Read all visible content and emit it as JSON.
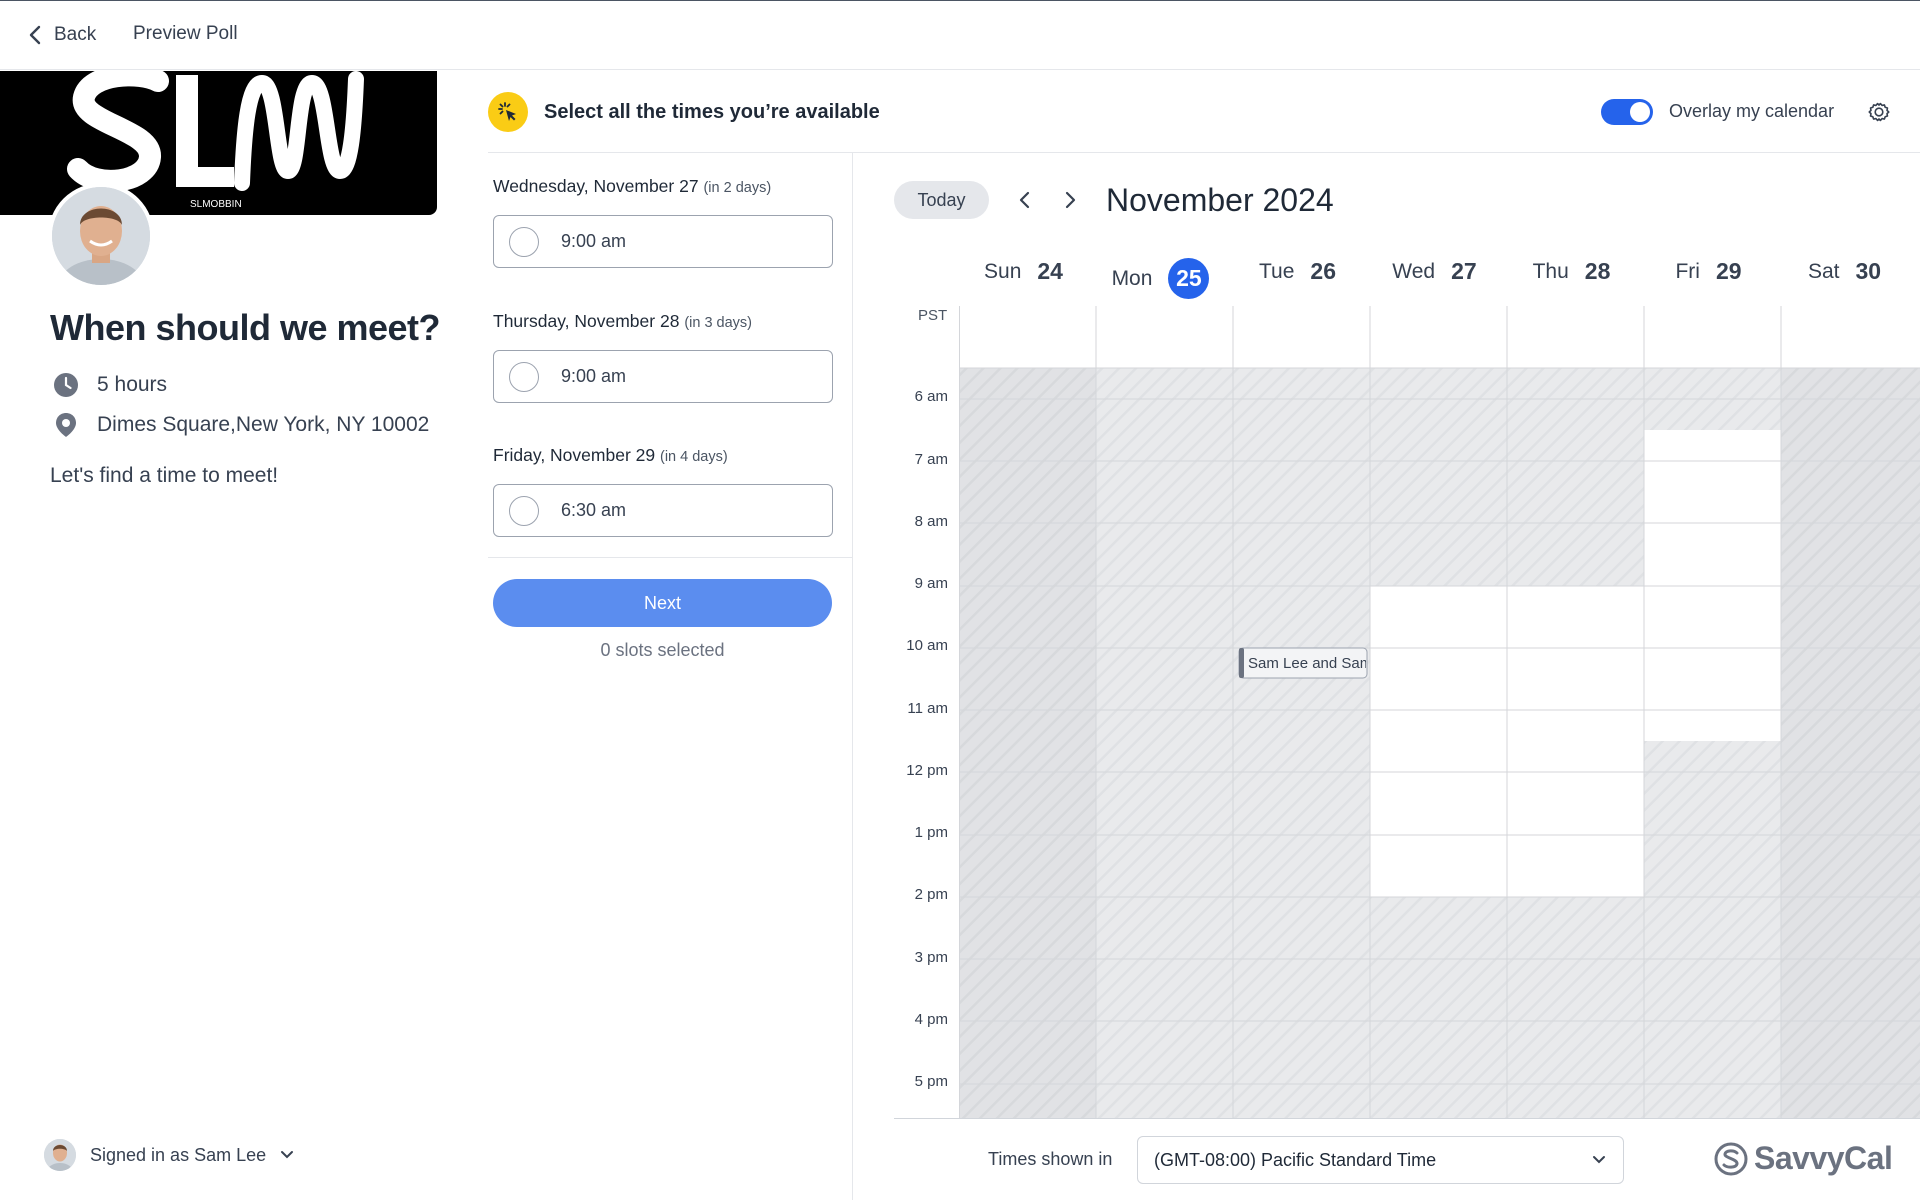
{
  "topbar": {
    "back_label": "Back",
    "title": "Preview Poll"
  },
  "host": {
    "banner_logo": "SLM",
    "banner_sub": "SLMOBBIN"
  },
  "event": {
    "title": "When should we meet?",
    "duration": "5 hours",
    "location": "Dimes Square,New York, NY 10002",
    "description": "Let's find a time to meet!"
  },
  "account": {
    "signed_in_label": "Signed in as Sam Lee"
  },
  "instruction": "Select all the times you’re available",
  "overlay": {
    "label": "Overlay my calendar",
    "enabled": true
  },
  "slots": [
    {
      "day": "Wednesday, November 27",
      "relative": "(in 2 days)",
      "time": "9:00 am"
    },
    {
      "day": "Thursday, November 28",
      "relative": "(in 3 days)",
      "time": "9:00 am"
    },
    {
      "day": "Friday, November 29",
      "relative": "(in 4 days)",
      "time": "6:30 am"
    }
  ],
  "next_label": "Next",
  "slots_selected": "0 slots selected",
  "calendar": {
    "today_label": "Today",
    "month": "November 2024",
    "timezone_abbr": "PST",
    "days": [
      {
        "name": "Sun",
        "num": "24",
        "today": false
      },
      {
        "name": "Mon",
        "num": "25",
        "today": true
      },
      {
        "name": "Tue",
        "num": "26",
        "today": false
      },
      {
        "name": "Wed",
        "num": "27",
        "today": false
      },
      {
        "name": "Thu",
        "num": "28",
        "today": false
      },
      {
        "name": "Fri",
        "num": "29",
        "today": false
      },
      {
        "name": "Sat",
        "num": "30",
        "today": false
      }
    ],
    "hours": [
      "6 am",
      "7 am",
      "8 am",
      "9 am",
      "10 am",
      "11 am",
      "12 pm",
      "1 pm",
      "2 pm",
      "3 pm",
      "4 pm",
      "5 pm"
    ],
    "event_block": {
      "label": "Sam Lee and Sam",
      "day_index": 2
    },
    "colors": {
      "today": "#2563eb",
      "hatch": "#e5e7eb",
      "hatch_weekend": "#dcdde0"
    }
  },
  "timezone": {
    "label": "Times shown in",
    "value": "(GMT-08:00) Pacific Standard Time"
  },
  "brand": {
    "name": "SavvyCal"
  }
}
